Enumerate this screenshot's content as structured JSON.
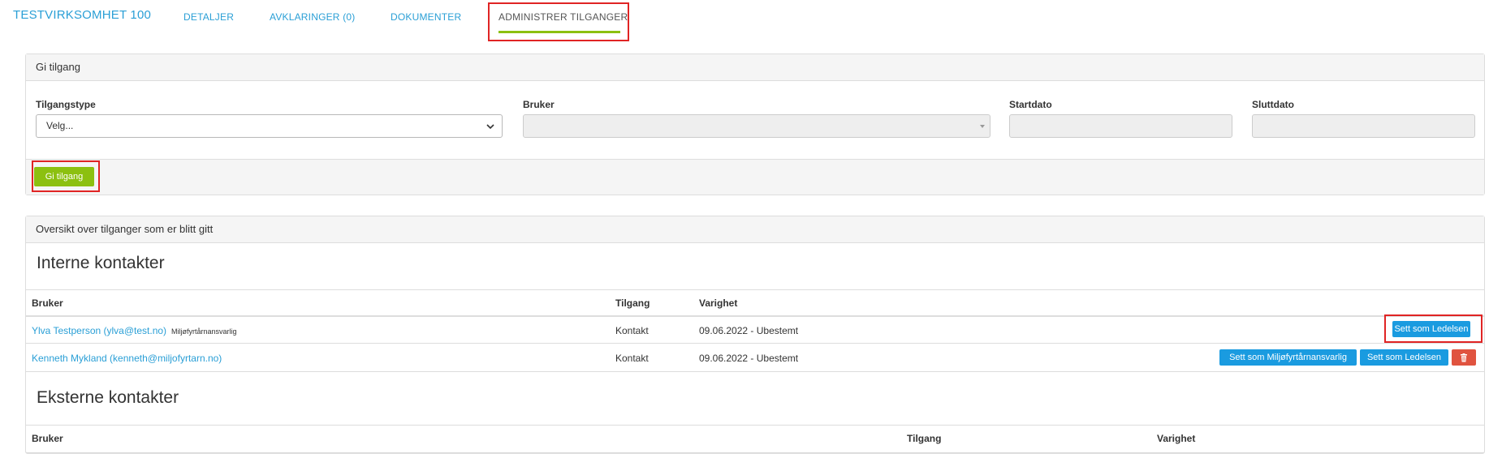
{
  "nav": {
    "brand": "TESTVIRKSOMHET 100",
    "tabs": [
      {
        "label": "DETALJER"
      },
      {
        "label": "AVKLARINGER (0)"
      },
      {
        "label": "DOKUMENTER"
      },
      {
        "label": "ADMINISTRER TILGANGER"
      }
    ],
    "active_tab": "ADMINISTRER TILGANGER"
  },
  "grant_panel": {
    "heading": "Gi tilgang",
    "fields": {
      "access_type": {
        "label": "Tilgangstype",
        "value": "Velg..."
      },
      "user": {
        "label": "Bruker",
        "value": ""
      },
      "start_date": {
        "label": "Startdato",
        "value": ""
      },
      "end_date": {
        "label": "Sluttdato",
        "value": ""
      }
    },
    "submit_label": "Gi tilgang"
  },
  "overview_panel": {
    "heading": "Oversikt over tilganger som er blitt gitt",
    "internal": {
      "title": "Interne kontakter",
      "columns": [
        "Bruker",
        "Tilgang",
        "Varighet"
      ],
      "rows": [
        {
          "user": "Ylva Testperson (ylva@test.no)",
          "role_tag": "Miljøfyrtårnansvarlig",
          "access": "Kontakt",
          "duration": "09.06.2022 - Ubestemt",
          "actions": [
            "Sett som Ledelsen"
          ]
        },
        {
          "user": "Kenneth Mykland (kenneth@miljofyrtarn.no)",
          "role_tag": "",
          "access": "Kontakt",
          "duration": "09.06.2022 - Ubestemt",
          "actions": [
            "Sett som Miljøfyrtårnansvarlig",
            "Sett som Ledelsen"
          ]
        }
      ]
    },
    "external": {
      "title": "Eksterne kontakter",
      "columns": [
        "Bruker",
        "Tilgang",
        "Varighet"
      ],
      "rows": []
    }
  },
  "colors": {
    "link": "#2a9fd6",
    "accent_green": "#8cc010",
    "button_blue": "#1a9be0",
    "button_red": "#e0533f",
    "highlight_red": "#e02424"
  },
  "icons": {
    "delete": "trash-icon",
    "select": "chevron-down-icon"
  }
}
